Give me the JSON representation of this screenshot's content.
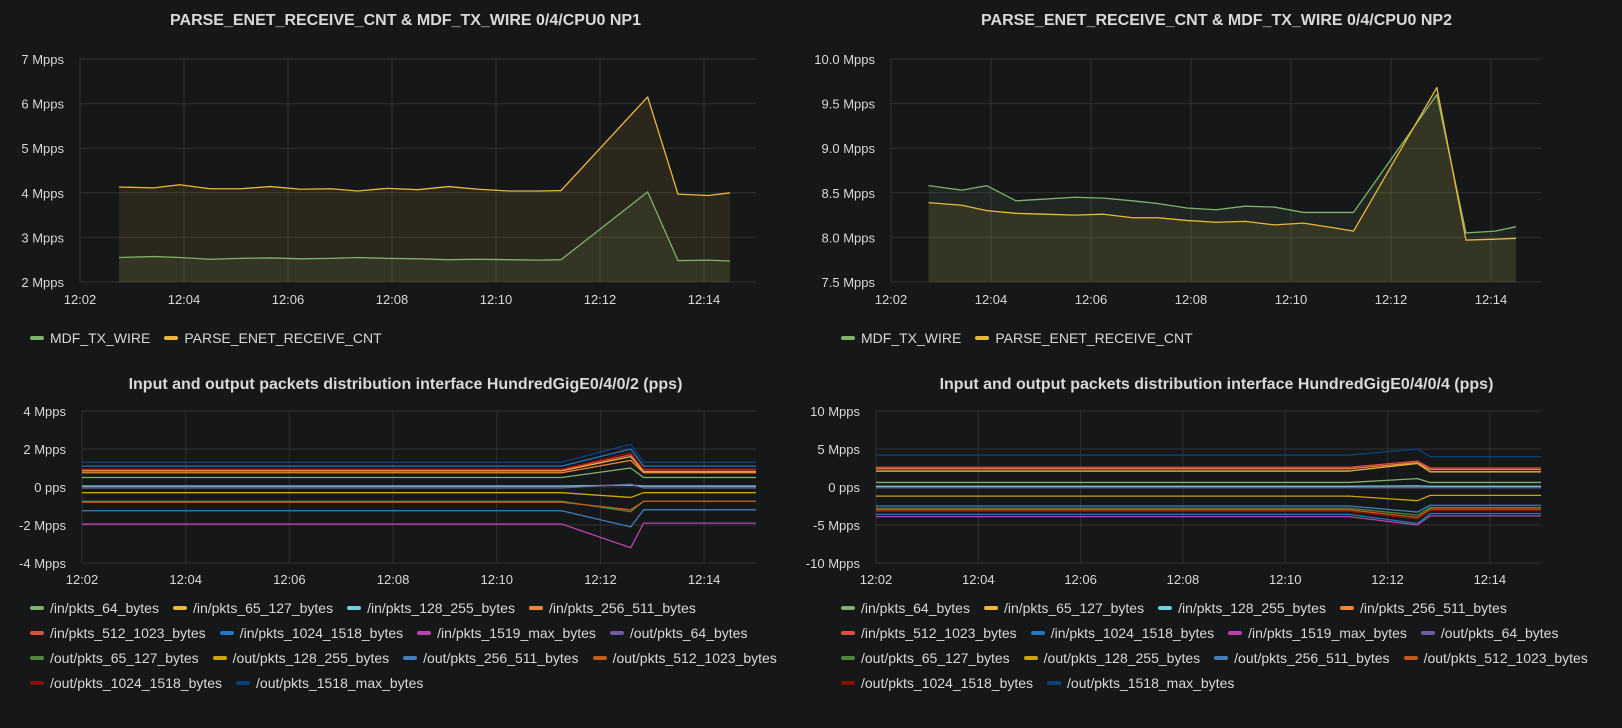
{
  "chart_data": [
    {
      "type": "area",
      "title": "PARSE_ENET_RECEIVE_CNT & MDF_TX_WIRE 0/4/CPU0 NP1",
      "x_ticks": [
        "12:02",
        "12:04",
        "12:06",
        "12:08",
        "12:10",
        "12:12",
        "12:14"
      ],
      "y_ticks": [
        {
          "value": 7,
          "label": "7 Mpps"
        },
        {
          "value": 6,
          "label": "6 Mpps"
        },
        {
          "value": 5,
          "label": "5 Mpps"
        },
        {
          "value": 4,
          "label": "4 Mpps"
        },
        {
          "value": 3,
          "label": "3 Mpps"
        },
        {
          "value": 2,
          "label": "2 Mpps"
        }
      ],
      "xlim": [
        "12:02",
        "12:15"
      ],
      "ylim": [
        2,
        7
      ],
      "grid": true,
      "legend_position": "bottom",
      "x": [
        "12:02:45",
        "12:03:25",
        "12:03:55",
        "12:04:30",
        "12:05:05",
        "12:05:40",
        "12:06:15",
        "12:06:50",
        "12:07:20",
        "12:07:55",
        "12:08:30",
        "12:09:05",
        "12:09:40",
        "12:10:15",
        "12:10:50",
        "12:11:15",
        "12:12:55",
        "12:13:30",
        "12:14:05",
        "12:14:30"
      ],
      "series": [
        {
          "name": "MDF_TX_WIRE",
          "color": "#7eb26d",
          "fill": true,
          "values": [
            2.55,
            2.57,
            2.55,
            2.51,
            2.53,
            2.54,
            2.52,
            2.53,
            2.55,
            2.53,
            2.52,
            2.5,
            2.51,
            2.5,
            2.49,
            2.5,
            4.02,
            2.48,
            2.49,
            2.47
          ]
        },
        {
          "name": "PARSE_ENET_RECEIVE_CNT",
          "color": "#eab839",
          "fill": true,
          "values": [
            4.13,
            4.11,
            4.18,
            4.09,
            4.09,
            4.14,
            4.08,
            4.09,
            4.04,
            4.1,
            4.07,
            4.14,
            4.08,
            4.04,
            4.04,
            4.05,
            6.15,
            3.97,
            3.94,
            4.0
          ]
        }
      ]
    },
    {
      "type": "area",
      "title": "PARSE_ENET_RECEIVE_CNT & MDF_TX_WIRE 0/4/CPU0 NP2",
      "x_ticks": [
        "12:02",
        "12:04",
        "12:06",
        "12:08",
        "12:10",
        "12:12",
        "12:14"
      ],
      "y_ticks": [
        {
          "value": 10.0,
          "label": "10.0 Mpps"
        },
        {
          "value": 9.5,
          "label": "9.5 Mpps"
        },
        {
          "value": 9.0,
          "label": "9.0 Mpps"
        },
        {
          "value": 8.5,
          "label": "8.5 Mpps"
        },
        {
          "value": 8.0,
          "label": "8.0 Mpps"
        },
        {
          "value": 7.5,
          "label": "7.5 Mpps"
        }
      ],
      "xlim": [
        "12:02",
        "12:15"
      ],
      "ylim": [
        7.5,
        10.0
      ],
      "grid": true,
      "legend_position": "bottom",
      "x": [
        "12:02:45",
        "12:03:25",
        "12:03:55",
        "12:04:30",
        "12:05:05",
        "12:05:40",
        "12:06:15",
        "12:06:50",
        "12:07:20",
        "12:07:55",
        "12:08:30",
        "12:09:05",
        "12:09:40",
        "12:10:15",
        "12:10:50",
        "12:11:15",
        "12:12:55",
        "12:13:30",
        "12:14:05",
        "12:14:30"
      ],
      "series": [
        {
          "name": "MDF_TX_WIRE",
          "color": "#7eb26d",
          "fill": true,
          "values": [
            8.58,
            8.53,
            8.58,
            8.41,
            8.43,
            8.45,
            8.44,
            8.41,
            8.38,
            8.33,
            8.31,
            8.35,
            8.34,
            8.28,
            8.28,
            8.28,
            9.6,
            8.05,
            8.07,
            8.12
          ]
        },
        {
          "name": "PARSE_ENET_RECEIVE_CNT",
          "color": "#eab839",
          "fill": true,
          "values": [
            8.39,
            8.36,
            8.3,
            8.27,
            8.26,
            8.25,
            8.26,
            8.22,
            8.22,
            8.19,
            8.17,
            8.18,
            8.14,
            8.16,
            8.11,
            8.07,
            9.68,
            7.97,
            7.98,
            7.99
          ]
        }
      ]
    },
    {
      "type": "line",
      "title": "Input and output packets distribution interface HundredGigE0/4/0/2 (pps)",
      "x_ticks": [
        "12:02",
        "12:04",
        "12:06",
        "12:08",
        "12:10",
        "12:12",
        "12:14"
      ],
      "y_ticks": [
        {
          "value": 4,
          "label": "4 Mpps"
        },
        {
          "value": 2,
          "label": "2 Mpps"
        },
        {
          "value": 0,
          "label": "0 pps"
        },
        {
          "value": -2,
          "label": "-2 Mpps"
        },
        {
          "value": -4,
          "label": "-4 Mpps"
        }
      ],
      "xlim": [
        "12:02",
        "12:15"
      ],
      "ylim": [
        -4,
        4
      ],
      "grid": true,
      "legend_position": "bottom",
      "x": [
        "12:02",
        "12:11:15",
        "12:12:35",
        "12:12:50",
        "12:15"
      ],
      "series": [
        {
          "name": "/in/pkts_64_bytes",
          "color": "#7eb26d",
          "values": [
            0.5,
            0.5,
            1.0,
            0.5,
            0.5
          ]
        },
        {
          "name": "/in/pkts_65_127_bytes",
          "color": "#eab839",
          "values": [
            0.85,
            0.85,
            1.6,
            0.8,
            0.8
          ]
        },
        {
          "name": "/in/pkts_128_255_bytes",
          "color": "#6ed0e0",
          "values": [
            0.05,
            0.05,
            0.1,
            0.05,
            0.05
          ]
        },
        {
          "name": "/in/pkts_256_511_bytes",
          "color": "#ef843c",
          "values": [
            0.75,
            0.75,
            1.4,
            0.75,
            0.75
          ]
        },
        {
          "name": "/in/pkts_512_1023_bytes",
          "color": "#e24d42",
          "values": [
            0.9,
            0.9,
            1.7,
            0.9,
            0.9
          ]
        },
        {
          "name": "/in/pkts_1024_1518_bytes",
          "color": "#1f78c1",
          "values": [
            1.1,
            1.1,
            2.0,
            1.1,
            1.1
          ]
        },
        {
          "name": "/in/pkts_1519_max_bytes",
          "color": "#ba43a9",
          "values": [
            -1.95,
            -1.95,
            -3.2,
            -1.9,
            -1.9
          ]
        },
        {
          "name": "/out/pkts_64_bytes",
          "color": "#705da0",
          "values": [
            -0.05,
            -0.05,
            0.15,
            -0.05,
            -0.05
          ]
        },
        {
          "name": "/out/pkts_65_127_bytes",
          "color": "#508642",
          "values": [
            -0.75,
            -0.75,
            -1.3,
            -0.75,
            -0.75
          ]
        },
        {
          "name": "/out/pkts_128_255_bytes",
          "color": "#cca300",
          "values": [
            -0.3,
            -0.3,
            -0.55,
            -0.3,
            -0.3
          ]
        },
        {
          "name": "/out/pkts_256_511_bytes",
          "color": "#447ebc",
          "values": [
            -1.25,
            -1.25,
            -2.1,
            -1.2,
            -1.2
          ]
        },
        {
          "name": "/out/pkts_512_1023_bytes",
          "color": "#c15c17",
          "values": [
            -0.8,
            -0.8,
            -1.2,
            -0.75,
            -0.75
          ]
        },
        {
          "name": "/out/pkts_1024_1518_bytes",
          "color": "#890f02",
          "values": [
            0.95,
            0.95,
            1.8,
            0.95,
            0.95
          ]
        },
        {
          "name": "/out/pkts_1518_max_bytes",
          "color": "#0a437c",
          "values": [
            1.3,
            1.3,
            2.25,
            1.3,
            1.3
          ]
        }
      ]
    },
    {
      "type": "line",
      "title": "Input and output packets distribution interface HundredGigE0/4/0/4 (pps)",
      "x_ticks": [
        "12:02",
        "12:04",
        "12:06",
        "12:08",
        "12:10",
        "12:12",
        "12:14"
      ],
      "y_ticks": [
        {
          "value": 10,
          "label": "10 Mpps"
        },
        {
          "value": 5,
          "label": "5 Mpps"
        },
        {
          "value": 0,
          "label": "0 pps"
        },
        {
          "value": -5,
          "label": "-5 Mpps"
        },
        {
          "value": -10,
          "label": "-10 Mpps"
        }
      ],
      "xlim": [
        "12:02",
        "12:15"
      ],
      "ylim": [
        -10,
        10
      ],
      "grid": true,
      "legend_position": "bottom",
      "x": [
        "12:02",
        "12:11:15",
        "12:12:35",
        "12:12:50",
        "12:15"
      ],
      "series": [
        {
          "name": "/in/pkts_64_bytes",
          "color": "#7eb26d",
          "values": [
            0.6,
            0.6,
            1.1,
            0.6,
            0.6
          ]
        },
        {
          "name": "/in/pkts_65_127_bytes",
          "color": "#eab839",
          "values": [
            2.1,
            2.1,
            3.1,
            2.0,
            2.0
          ]
        },
        {
          "name": "/in/pkts_128_255_bytes",
          "color": "#6ed0e0",
          "values": [
            0.1,
            0.1,
            0.15,
            0.1,
            0.1
          ]
        },
        {
          "name": "/in/pkts_256_511_bytes",
          "color": "#ef843c",
          "values": [
            2.4,
            2.4,
            3.2,
            2.3,
            2.3
          ]
        },
        {
          "name": "/in/pkts_512_1023_bytes",
          "color": "#e24d42",
          "values": [
            2.6,
            2.6,
            3.4,
            2.5,
            2.5
          ]
        },
        {
          "name": "/in/pkts_1024_1518_bytes",
          "color": "#1f78c1",
          "values": [
            -3.6,
            -3.6,
            -4.8,
            -3.5,
            -3.5
          ]
        },
        {
          "name": "/in/pkts_1519_max_bytes",
          "color": "#ba43a9",
          "values": [
            -3.9,
            -3.9,
            -5.0,
            -3.8,
            -3.8
          ]
        },
        {
          "name": "/out/pkts_64_bytes",
          "color": "#705da0",
          "values": [
            -0.1,
            -0.1,
            -0.1,
            -0.1,
            -0.1
          ]
        },
        {
          "name": "/out/pkts_65_127_bytes",
          "color": "#508642",
          "values": [
            -2.8,
            -2.8,
            -3.7,
            -2.7,
            -2.7
          ]
        },
        {
          "name": "/out/pkts_128_255_bytes",
          "color": "#cca300",
          "values": [
            -1.2,
            -1.2,
            -1.8,
            -1.1,
            -1.1
          ]
        },
        {
          "name": "/out/pkts_256_511_bytes",
          "color": "#447ebc",
          "values": [
            -2.5,
            -2.5,
            -3.3,
            -2.4,
            -2.4
          ]
        },
        {
          "name": "/out/pkts_512_1023_bytes",
          "color": "#c15c17",
          "values": [
            -3.0,
            -3.0,
            -4.0,
            -2.9,
            -2.9
          ]
        },
        {
          "name": "/out/pkts_1024_1518_bytes",
          "color": "#890f02",
          "values": [
            -3.2,
            -3.2,
            -4.2,
            -3.1,
            -3.1
          ]
        },
        {
          "name": "/out/pkts_1518_max_bytes",
          "color": "#0a437c",
          "values": [
            4.2,
            4.2,
            5.0,
            4.0,
            4.0
          ]
        }
      ]
    }
  ]
}
